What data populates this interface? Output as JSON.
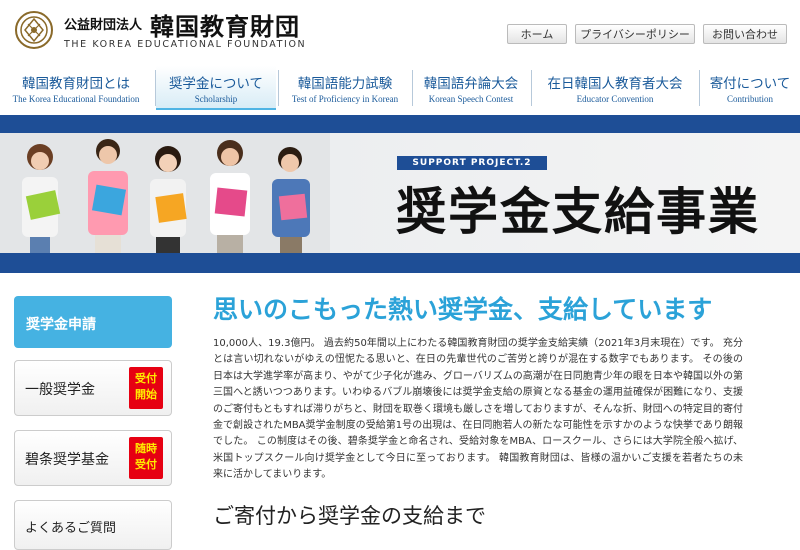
{
  "header": {
    "org_type": "公益財団法人",
    "org_name": "韓国教育財団",
    "org_name_en": "THE KOREA EDUCATIONAL FOUNDATION",
    "logo_icon": "foundation-emblem-icon",
    "util_links": [
      {
        "label": "ホーム"
      },
      {
        "label": "プライバシーポリシー"
      },
      {
        "label": "お問い合わせ"
      }
    ]
  },
  "nav": {
    "items": [
      {
        "jp": "韓国教育財団とは",
        "en": "The Korea Educational Foundation"
      },
      {
        "jp": "奨学金について",
        "en": "Scholarship",
        "active": true
      },
      {
        "jp": "韓国語能力試験",
        "en": "Test of Proficiency in Korean"
      },
      {
        "jp": "韓国語弁論大会",
        "en": "Korean Speech Contest"
      },
      {
        "jp": "在日韓国人教育者大会",
        "en": "Educator Convention"
      },
      {
        "jp": "寄付について",
        "en": "Contribution"
      }
    ],
    "active_color": "#4fb4e4",
    "text_color": "#1a5a9a"
  },
  "hero": {
    "badge": "SUPPORT PROJECT.2",
    "title": "奨学金支給事業",
    "band_color": "#1e4e96"
  },
  "sidebar": {
    "apply_label": "奨学金申請",
    "general": {
      "label": "一般奨学金",
      "tag_line1": "受付",
      "tag_line2": "開始"
    },
    "hekijo": {
      "label": "碧条奨学基金",
      "tag_line1": "随時",
      "tag_line2": "受付"
    },
    "faq_label": "よくあるご質問",
    "apply_color": "#45b2e2",
    "tag_color": "#e60012",
    "tag_text_color": "#ffeb00"
  },
  "main": {
    "heading": "思いのこもった熱い奨学金、支給しています",
    "heading_color": "#2ba2d8",
    "body": "10,000人、19.3億円。 過去約50年間以上にわたる韓国教育財団の奨学金支給実績（2021年3月末現在）です。 充分とは言い切れないがゆえの忸怩たる思いと、在日の先輩世代のご苦労と誇りが混在する数字でもあります。 その後の日本は大学進学率が高まり、やがて少子化が進み、グローバリズムの高潮が在日同胞青少年の眼を日本や韓国以外の第三国へと誘いつつあります。いわゆるバブル崩壊後には奨学金支給の原資となる基金の運用益確保が困難になり、支援のご寄付もともすれば滞りがちと、財団を取巻く環境も厳しさを増しておりますが、そんな折、財団への特定目的寄付金で創設されたMBA奨学金制度の受給第1号の出現は、在日同胞若人の新たな可能性を示すかのような快挙であり朗報でした。 この制度はその後、碧条奨学金と命名され、受給対象をMBA、ロースクール、さらには大学院全般へ拡げ、米国トップスクール向け奨学金として今日に至っております。 韓国教育財団は、皆様の温かいご支援を若者たちの未来に活かしてまいります。",
    "sub_heading": "ご寄付から奨学金の支給まで"
  }
}
